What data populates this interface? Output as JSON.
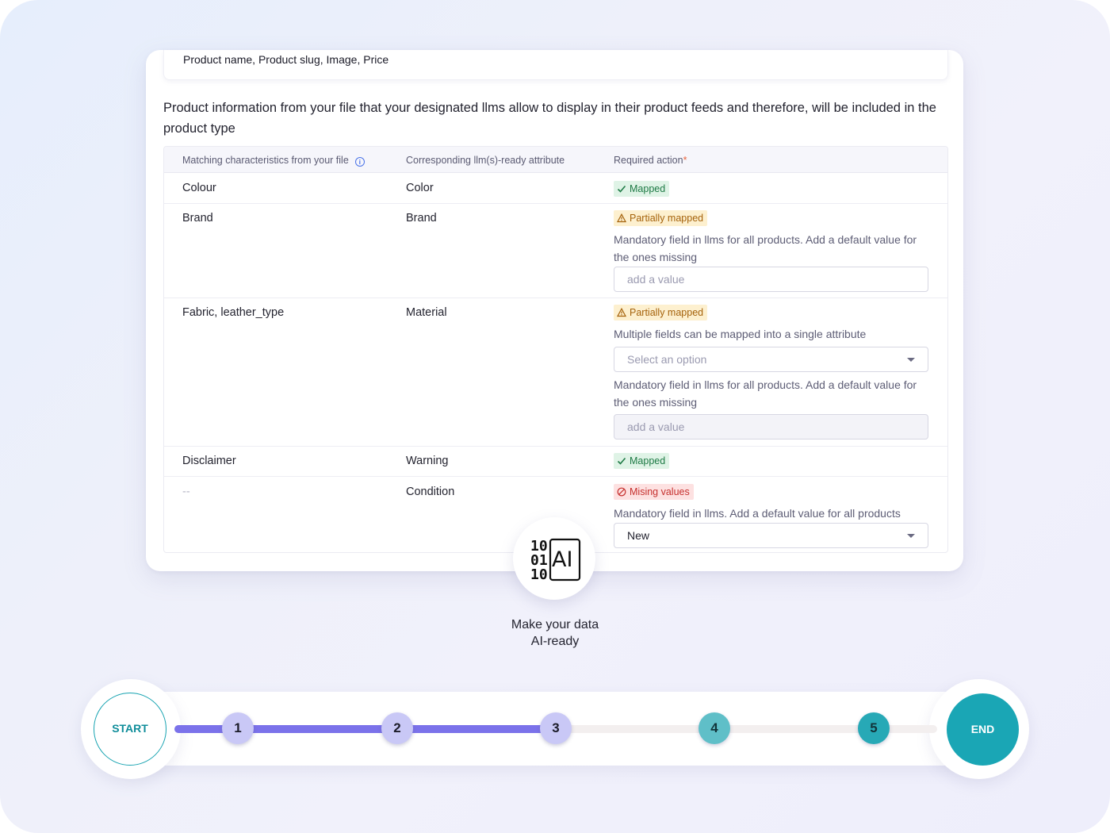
{
  "previous_summary": "Product name, Product slug, Image, Price",
  "description": "Product information from your file that your designated llms allow to display in their product feeds and therefore, will be included in the product type",
  "table": {
    "headers": {
      "col1": "Matching characteristics from your file",
      "col2": "Corresponding llm(s)-ready attribute",
      "col3": "Required action",
      "required_mark": "*"
    },
    "rows": [
      {
        "file": "Colour",
        "attribute": "Color",
        "status": "Mapped"
      },
      {
        "file": "Brand",
        "attribute": "Brand",
        "status": "Partially mapped",
        "note": "Mandatory field in llms for all products. Add a default value for the ones missing",
        "input_placeholder": "add a value"
      },
      {
        "file": "Fabric, leather_type",
        "attribute": "Material",
        "status": "Partially mapped",
        "note1": "Multiple fields can be mapped into a single attribute",
        "select_placeholder": "Select an option",
        "note2": "Mandatory field in llms for all products. Add a default value for the ones missing",
        "input_placeholder": "add a value"
      },
      {
        "file": "Disclaimer",
        "attribute": "Warning",
        "status": "Mapped"
      },
      {
        "file": "--",
        "attribute": "Condition",
        "status": "Mising values",
        "note": "Mandatory field in llms. Add a default value for all products",
        "select_value": "New"
      }
    ]
  },
  "ai_badge": {
    "icon_digits": [
      "10",
      "01",
      "10"
    ],
    "icon_text": "AI",
    "caption_line1": "Make your data",
    "caption_line2": "AI-ready"
  },
  "progress": {
    "start_label": "START",
    "end_label": "END",
    "steps": [
      "1",
      "2",
      "3",
      "4",
      "5"
    ],
    "current_step": 3,
    "colors": {
      "done": "#7b72ea",
      "todo": "#1aa6b5"
    }
  }
}
